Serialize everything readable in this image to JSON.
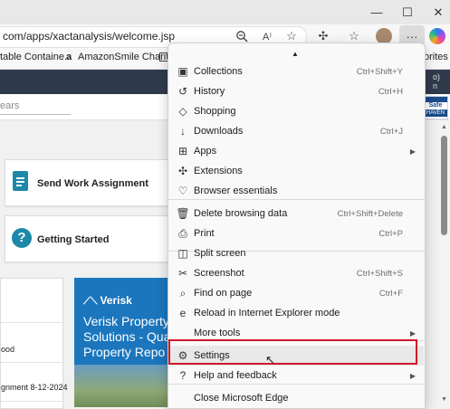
{
  "browser": {
    "url_text": "com/apps/xactanalysis/welcome.jsp",
    "favorites": [
      {
        "icon": "page-icon",
        "label": "table Containe..."
      },
      {
        "icon": "amazon-icon",
        "label": "AmazonSmile Charit..."
      }
    ],
    "favorites_overflow_label": "orites"
  },
  "page": {
    "years_placeholder": "ears",
    "cards": [
      {
        "icon": "clipboard-icon",
        "label": "Send Work Assignment"
      },
      {
        "icon": "question-icon",
        "label": "Getting Started"
      }
    ],
    "list_items": [
      "ood",
      "gnment 8-12-2024"
    ],
    "promo": {
      "brand": "Verisk",
      "headline_lines": [
        "Verisk Property",
        "Solutions - Qua",
        "Property Repo"
      ]
    },
    "header_right_text": "o)",
    "header_right_sub": "n",
    "badge_text_1": "Safe",
    "badge_text_2": "HAVEN"
  },
  "menu": {
    "items": [
      {
        "name": "collections",
        "icon": "collections-icon",
        "glyph": "▣",
        "label": "Collections",
        "shortcut": "Ctrl+Shift+Y"
      },
      {
        "name": "history",
        "icon": "history-icon",
        "glyph": "↺",
        "label": "History",
        "shortcut": "Ctrl+H"
      },
      {
        "name": "shopping",
        "icon": "tag-icon",
        "glyph": "◇",
        "label": "Shopping",
        "shortcut": ""
      },
      {
        "name": "downloads",
        "icon": "download-icon",
        "glyph": "↓",
        "label": "Downloads",
        "shortcut": "Ctrl+J"
      },
      {
        "name": "apps",
        "icon": "apps-icon",
        "glyph": "⊞",
        "label": "Apps",
        "shortcut": "",
        "submenu": true
      },
      {
        "name": "extensions",
        "icon": "puzzle-icon",
        "glyph": "✣",
        "label": "Extensions",
        "shortcut": ""
      },
      {
        "name": "browser-essentials",
        "icon": "heart-pulse-icon",
        "glyph": "♡",
        "label": "Browser essentials",
        "shortcut": ""
      },
      {
        "name": "delete-browsing-data",
        "icon": "trash-icon",
        "glyph": "🗑",
        "label": "Delete browsing data",
        "shortcut": "Ctrl+Shift+Delete"
      },
      {
        "name": "print",
        "icon": "printer-icon",
        "glyph": "⎙",
        "label": "Print",
        "shortcut": "Ctrl+P"
      },
      {
        "name": "split-screen",
        "icon": "split-screen-icon",
        "glyph": "◫",
        "label": "Split screen",
        "shortcut": ""
      },
      {
        "name": "screenshot",
        "icon": "screenshot-icon",
        "glyph": "✂",
        "label": "Screenshot",
        "shortcut": "Ctrl+Shift+S"
      },
      {
        "name": "find-on-page",
        "icon": "find-icon",
        "glyph": "⌕",
        "label": "Find on page",
        "shortcut": "Ctrl+F"
      },
      {
        "name": "ie-mode",
        "icon": "ie-icon",
        "glyph": "e",
        "label": "Reload in Internet Explorer mode",
        "shortcut": ""
      },
      {
        "name": "more-tools",
        "icon": "",
        "glyph": "",
        "label": "More tools",
        "shortcut": "",
        "submenu": true
      },
      {
        "name": "settings",
        "icon": "gear-icon",
        "glyph": "⚙",
        "label": "Settings",
        "shortcut": ""
      },
      {
        "name": "help-and-feedback",
        "icon": "help-icon",
        "glyph": "?",
        "label": "Help and feedback",
        "shortcut": "",
        "submenu": true
      },
      {
        "name": "close-edge",
        "icon": "",
        "glyph": "",
        "label": "Close Microsoft Edge",
        "shortcut": ""
      }
    ]
  },
  "colors": {
    "highlight_border": "#d0172a",
    "page_header": "#2f3b4c",
    "card_icon": "#1e88a8",
    "promo_bg": "#1b76bd"
  }
}
